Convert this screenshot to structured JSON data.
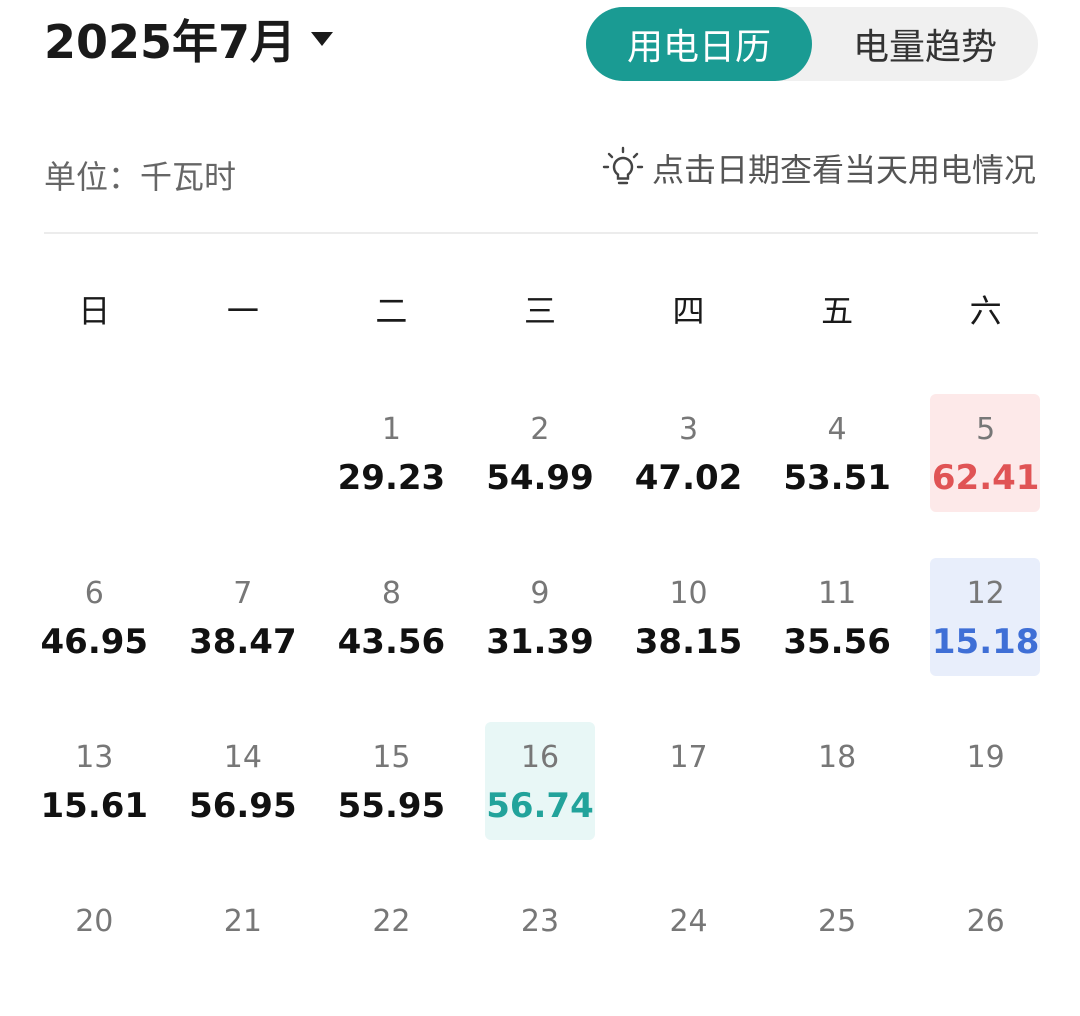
{
  "header": {
    "month_title": "2025年7月",
    "tabs": [
      {
        "label": "用电日历",
        "active": true
      },
      {
        "label": "电量趋势",
        "active": false
      }
    ]
  },
  "info": {
    "unit_label": "单位：千瓦时",
    "hint": "点击日期查看当天用电情况"
  },
  "weekdays": [
    "日",
    "一",
    "二",
    "三",
    "四",
    "五",
    "六"
  ],
  "colors": {
    "accent": "#1a9b93",
    "max_value": "#e05455",
    "min_value": "#3f6fd6",
    "selected": "#22a39b"
  },
  "calendar": {
    "weeks": [
      [
        {
          "day": "",
          "value": ""
        },
        {
          "day": "",
          "value": ""
        },
        {
          "day": "1",
          "value": "29.23"
        },
        {
          "day": "2",
          "value": "54.99"
        },
        {
          "day": "3",
          "value": "47.02"
        },
        {
          "day": "4",
          "value": "53.51"
        },
        {
          "day": "5",
          "value": "62.41",
          "highlight": "red"
        }
      ],
      [
        {
          "day": "6",
          "value": "46.95"
        },
        {
          "day": "7",
          "value": "38.47"
        },
        {
          "day": "8",
          "value": "43.56"
        },
        {
          "day": "9",
          "value": "31.39"
        },
        {
          "day": "10",
          "value": "38.15"
        },
        {
          "day": "11",
          "value": "35.56"
        },
        {
          "day": "12",
          "value": "15.18",
          "highlight": "blue"
        }
      ],
      [
        {
          "day": "13",
          "value": "15.61"
        },
        {
          "day": "14",
          "value": "56.95"
        },
        {
          "day": "15",
          "value": "55.95"
        },
        {
          "day": "16",
          "value": "56.74",
          "highlight": "teal"
        },
        {
          "day": "17",
          "value": ""
        },
        {
          "day": "18",
          "value": ""
        },
        {
          "day": "19",
          "value": ""
        }
      ],
      [
        {
          "day": "20",
          "value": ""
        },
        {
          "day": "21",
          "value": ""
        },
        {
          "day": "22",
          "value": ""
        },
        {
          "day": "23",
          "value": ""
        },
        {
          "day": "24",
          "value": ""
        },
        {
          "day": "25",
          "value": ""
        },
        {
          "day": "26",
          "value": ""
        }
      ]
    ]
  }
}
